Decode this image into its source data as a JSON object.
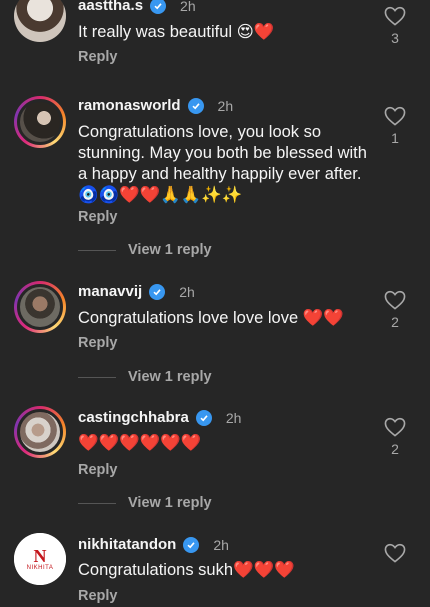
{
  "comments": [
    {
      "username": "aasttha.s",
      "time": "2h",
      "text": "It really was beautiful 😍❤️",
      "reply": "Reply",
      "likes": "3"
    },
    {
      "username": "ramonasworld",
      "time": "2h",
      "text": "Congratulations love, you look so stunning. May you both be blessed with a happy and healthy happily ever after. 🧿🧿❤️❤️🙏🙏✨✨",
      "reply": "Reply",
      "likes": "1",
      "view_replies": "View 1 reply"
    },
    {
      "username": "manavvij",
      "time": "2h",
      "text": "Congratulations love love love ❤️❤️",
      "reply": "Reply",
      "likes": "2",
      "view_replies": "View 1 reply"
    },
    {
      "username": "castingchhabra",
      "time": "2h",
      "text": "❤️❤️❤️❤️❤️❤️",
      "reply": "Reply",
      "likes": "2",
      "view_replies": "View 1 reply"
    },
    {
      "username": "nikhitatandon",
      "time": "2h",
      "text": "Congratulations sukh❤️❤️❤️",
      "reply": "Reply",
      "avatar_logo": "N",
      "avatar_logo_text": "NIKHITA"
    }
  ],
  "colors": {
    "background": "#262626",
    "verified": "#3897f0",
    "heart_red": "#e0245e",
    "secondary_text": "#a8a8a8"
  },
  "icons": {
    "like": "heart-outline-icon",
    "verified": "verified-badge-icon"
  }
}
